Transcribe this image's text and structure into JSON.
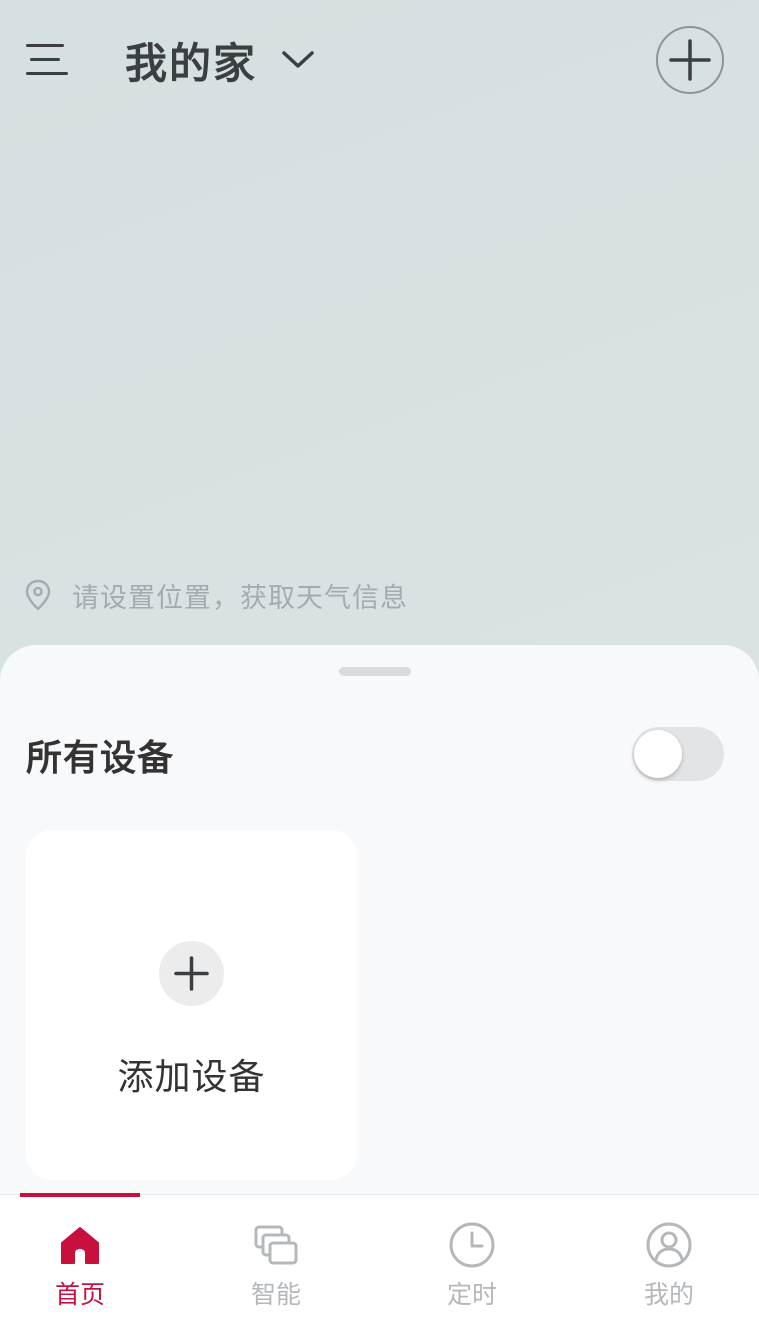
{
  "header": {
    "home_name": "我的家"
  },
  "location": {
    "prompt": "请设置位置，获取天气信息"
  },
  "devices": {
    "section_title": "所有设备",
    "toggle_on": false,
    "add_device_label": "添加设备"
  },
  "tabs": [
    {
      "label": "首页",
      "icon": "home-icon",
      "active": true
    },
    {
      "label": "智能",
      "icon": "smart-scenes-icon",
      "active": false
    },
    {
      "label": "定时",
      "icon": "clock-icon",
      "active": false
    },
    {
      "label": "我的",
      "icon": "profile-icon",
      "active": false
    }
  ],
  "colors": {
    "accent": "#c8103f",
    "inactive": "#b4b8bb",
    "text_primary": "#333333",
    "text_muted": "#a4abae"
  }
}
